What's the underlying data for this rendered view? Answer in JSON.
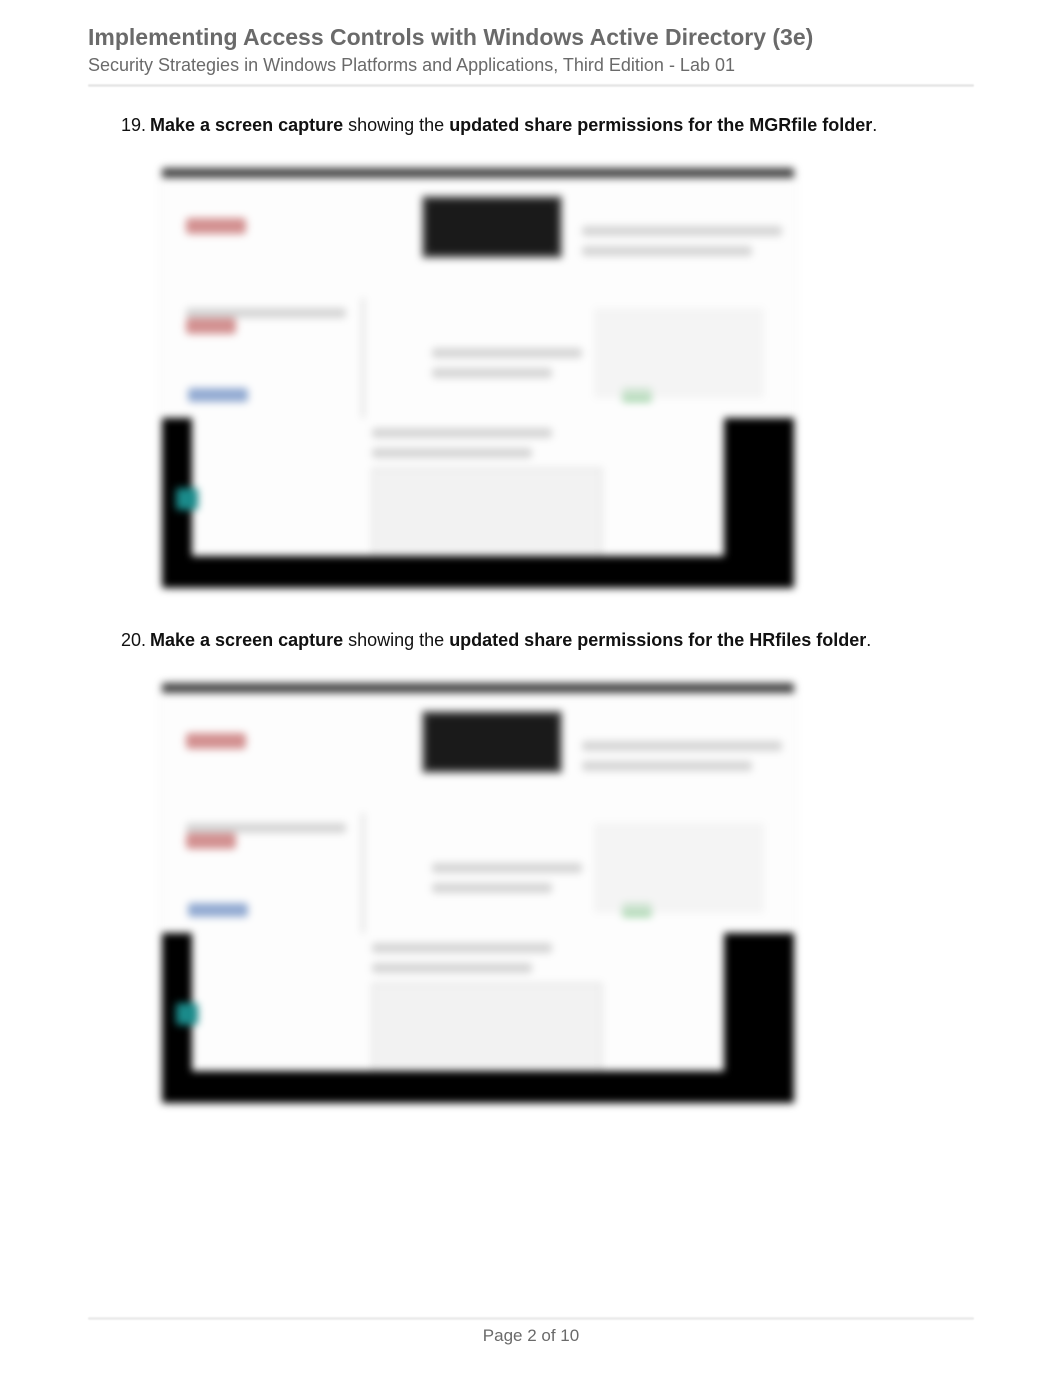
{
  "header": {
    "title": "Implementing Access Controls with Windows Active Directory (3e)",
    "subtitle": "Security Strategies in Windows Platforms and Applications, Third Edition - Lab 01"
  },
  "items": [
    {
      "number": "19.",
      "bold_lead": "Make a screen capture",
      "mid": " showing the ",
      "bold_trail": "updated share permissions for the MGRfile folder",
      "end": "."
    },
    {
      "number": "20.",
      "bold_lead": "Make a screen capture",
      "mid": " showing the ",
      "bold_trail": "updated share permissions for the HRfiles folder",
      "end": "."
    }
  ],
  "footer": {
    "page_label": "Page 2 of 10"
  }
}
